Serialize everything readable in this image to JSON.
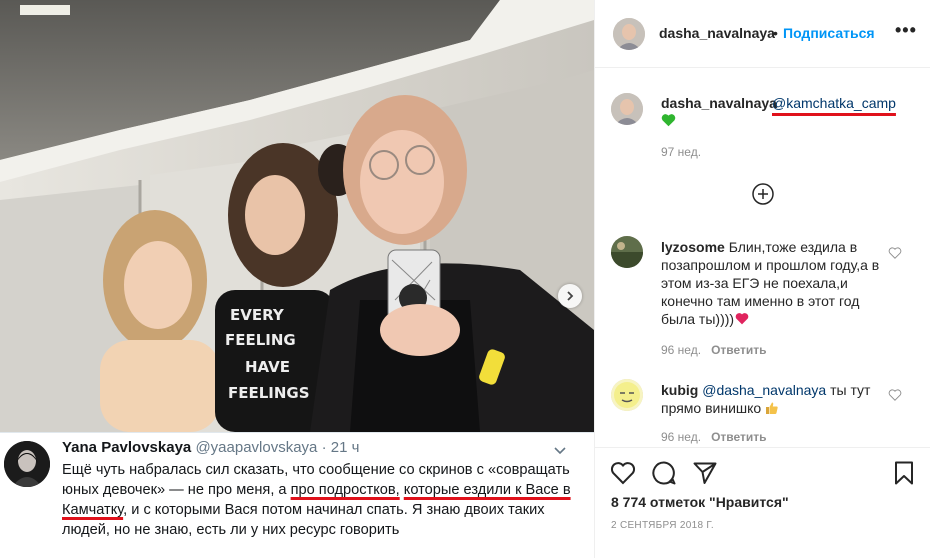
{
  "photo": {
    "next_button_icon": "chevron-right-icon",
    "shirt_text_lines": [
      "EVERY",
      "FEELING",
      "HAVE",
      "FEELINGS"
    ]
  },
  "tweet": {
    "name": "Yana Pavlovskaya",
    "handle": "@yaapavlovskaya",
    "separator": "·",
    "time": "21 ч",
    "text_part1": "Ещё чуть набралась сил сказать, что сообщение со скринов с «совращать юных девочек» — не про меня, а ",
    "text_underlined1": "про подростков,",
    "text_space": " ",
    "text_underlined2": "которые ездили к Васе в Камчатку",
    "text_part2": ", и с которыми Вася потом начинал спать. Я знаю двоих таких людей, но не знаю, есть ли у них ресурс говорить"
  },
  "post": {
    "username": "dasha_navalnaya",
    "separator": "•",
    "follow_label": "Подписаться",
    "more_label": "•••",
    "caption": {
      "username": "dasha_navalnaya",
      "mention": "@kamchatka_camp",
      "age": "97 нед."
    },
    "comments": [
      {
        "username": "lyzosome",
        "text": "Блин,тоже ездила в позапрошлом и прошлом году,а в этом из-за ЕГЭ не поехала,и конечно там именно в этот год была ты))))",
        "age": "96 нед.",
        "reply_label": "Ответить"
      },
      {
        "username": "kubig",
        "mention": "@dasha_navalnaya",
        "text": " ты тут прямо винишко",
        "age": "96 нед.",
        "reply_label": "Ответить"
      }
    ],
    "likes": "8 774 отметок \"Нравится\"",
    "date": "2 СЕНТЯБРЯ 2018 Г."
  },
  "colors": {
    "accent_blue": "#0095f6",
    "mention_blue": "#00376b",
    "highlight_red": "#e0111b",
    "green_heart": "#2fb52f",
    "red_heart": "#e0245e"
  }
}
